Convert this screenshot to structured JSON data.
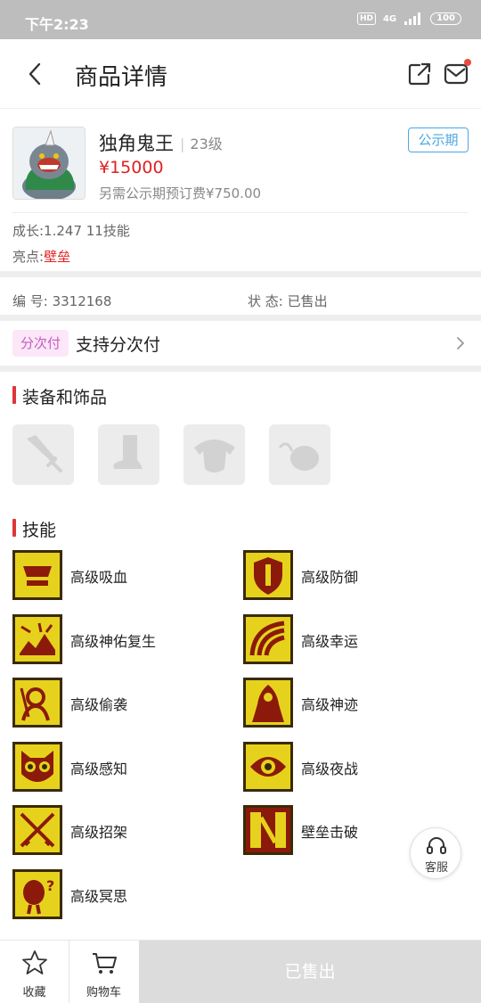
{
  "status_bar": {
    "time": "下午2:23",
    "hd": "HD",
    "network": "4G",
    "battery": "100"
  },
  "header": {
    "title": "商品详情"
  },
  "goods": {
    "name": "独角鬼王",
    "level": "23级",
    "price": "¥15000",
    "fee_note": "另需公示期预订费¥750.00",
    "badge": "公示期",
    "growth": "成长:1.247 11技能",
    "highlight_label": "亮点:",
    "highlight_value": "壁垒"
  },
  "info": {
    "number": "编  号:  3312168",
    "state": "状  态:  已售出"
  },
  "installment": {
    "tag": "分次付",
    "text": "支持分次付"
  },
  "equipment": {
    "title": "装备和饰品",
    "slots": [
      {
        "icon": "sword-icon"
      },
      {
        "icon": "boot-icon"
      },
      {
        "icon": "armor-icon"
      },
      {
        "icon": "ornament-icon"
      }
    ]
  },
  "skills": {
    "title": "技能",
    "items": [
      {
        "label": "高级吸血",
        "icon": "blood-suck-icon"
      },
      {
        "label": "高级防御",
        "icon": "shield-icon"
      },
      {
        "label": "高级神佑复生",
        "icon": "revive-icon"
      },
      {
        "label": "高级幸运",
        "icon": "luck-icon"
      },
      {
        "label": "高级偷袭",
        "icon": "sneak-attack-icon"
      },
      {
        "label": "高级神迹",
        "icon": "miracle-icon"
      },
      {
        "label": "高级感知",
        "icon": "owl-icon"
      },
      {
        "label": "高级夜战",
        "icon": "night-eye-icon"
      },
      {
        "label": "高级招架",
        "icon": "crossed-swords-icon"
      },
      {
        "label": "壁垒击破",
        "icon": "wall-break-icon"
      },
      {
        "label": "高级冥思",
        "icon": "meditate-icon"
      }
    ]
  },
  "customer_service": {
    "label": "客服"
  },
  "bottom_bar": {
    "favorite": "收藏",
    "cart": "购物车",
    "action": "已售出"
  },
  "colors": {
    "price_red": "#e02020",
    "badge_blue": "#4aa8e0",
    "accent_red": "#e03535",
    "skill_yellow": "#e6d21c"
  }
}
